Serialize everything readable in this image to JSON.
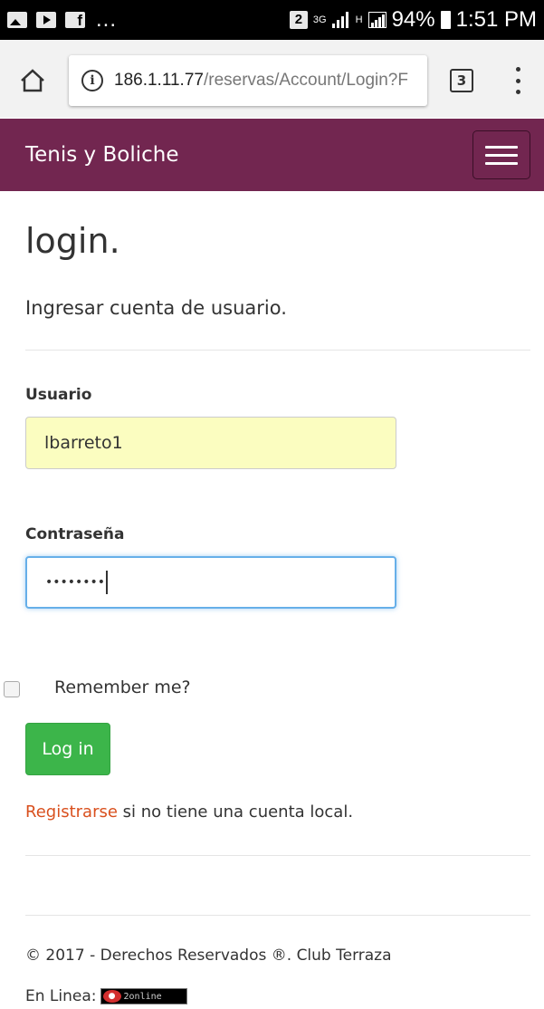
{
  "status_bar": {
    "notif_icons": [
      "gallery-icon",
      "youtube-icon",
      "facebook-icon"
    ],
    "overflow": "...",
    "sim_badge": "2",
    "network": "3G",
    "h_indicator": "H",
    "battery": "94%",
    "time": "1:51 PM"
  },
  "browser": {
    "url_host": "186.1.11.77",
    "url_path": "/reservas/Account/Login?F",
    "tab_count": "3"
  },
  "navbar": {
    "brand": "Tenis y Boliche"
  },
  "page": {
    "title": "login.",
    "subtitle": "Ingresar cuenta de usuario."
  },
  "form": {
    "username_label": "Usuario",
    "username_value": "lbarreto1",
    "password_label": "Contraseña",
    "password_value": "••••••••",
    "remember_label": "Remember me?",
    "remember_checked": false,
    "login_button": "Log in",
    "register_link": "Registrarse",
    "register_suffix": " si no tiene una cuenta local."
  },
  "footer": {
    "copyright": "© 2017 - Derechos Reservados ®. Club Terraza",
    "online_label": "En Linea:",
    "online_count": "2",
    "online_text": "online"
  },
  "colors": {
    "navbar": "#722650",
    "login_button": "#3cb54a",
    "link": "#d9501e",
    "autofill": "#fbfdc0"
  }
}
